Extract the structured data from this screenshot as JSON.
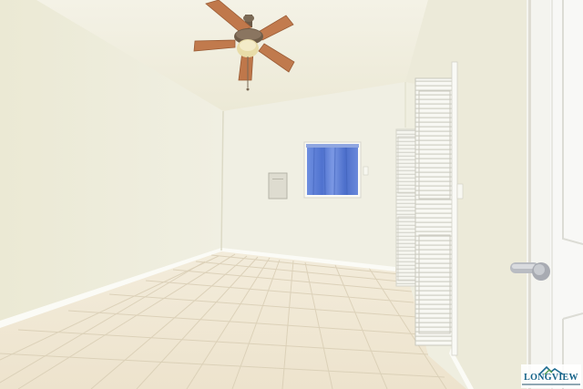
{
  "scene": {
    "description_colors": {
      "ceiling": "#f1efe0",
      "left_wall": "#ecead6",
      "back_wall": "#f0efe3",
      "right_wall": "#eceadb",
      "floor_tile": "#efe7d4",
      "grout": "#d8ccb3",
      "fan_blade": "#c17a4f",
      "curtain": "#5d80d6",
      "door": "#f7f7f5"
    }
  },
  "watermark": {
    "brand": "LONGVIEW"
  }
}
